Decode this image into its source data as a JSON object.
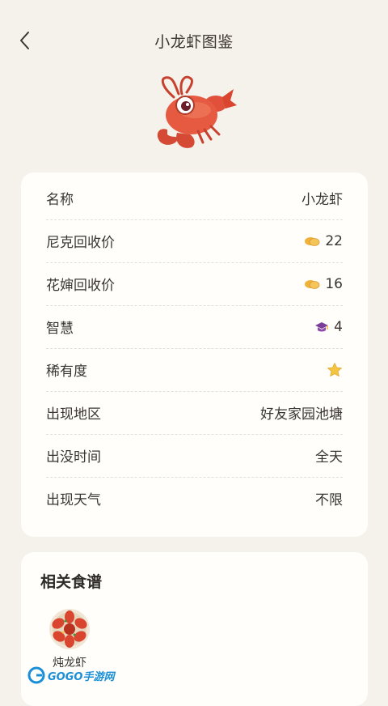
{
  "header": {
    "title": "小龙虾图鉴"
  },
  "info": {
    "rows": [
      {
        "label": "名称",
        "value": "小龙虾"
      },
      {
        "label": "尼克回收价",
        "value": "22",
        "icon": "coin-icon"
      },
      {
        "label": "花婶回收价",
        "value": "16",
        "icon": "coin-icon"
      },
      {
        "label": "智慧",
        "value": "4",
        "icon": "graduation-cap-icon"
      },
      {
        "label": "稀有度",
        "value": "",
        "icon": "star-icon",
        "rating": 1
      },
      {
        "label": "出现地区",
        "value": "好友家园池塘"
      },
      {
        "label": "出没时间",
        "value": "全天"
      },
      {
        "label": "出现天气",
        "value": "不限"
      }
    ]
  },
  "recipes": {
    "title": "相关食谱",
    "items": [
      {
        "name": "炖龙虾"
      }
    ]
  },
  "watermark": {
    "text": "GOGO手游网"
  },
  "colors": {
    "background": "#f5f2ec",
    "card": "#fffefb",
    "coin": "#f0b23a",
    "cap": "#7a3e9a",
    "star": "#f4c542",
    "crayfish": "#e0503a"
  }
}
